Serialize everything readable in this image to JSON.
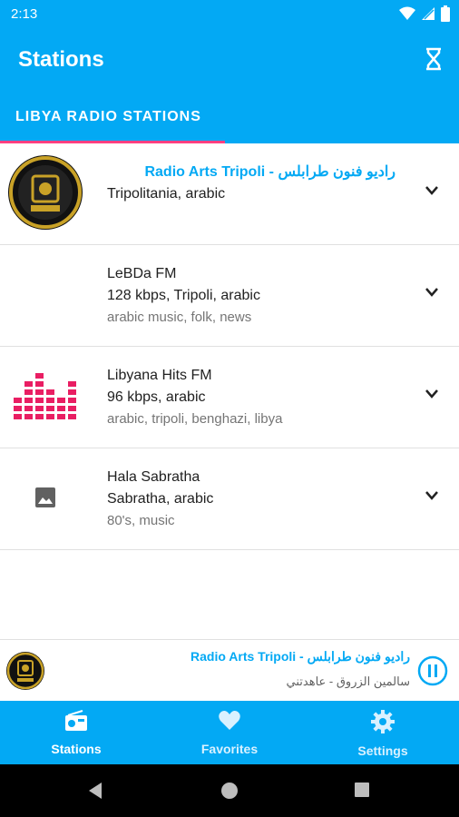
{
  "status_bar": {
    "time": "2:13"
  },
  "app_bar": {
    "title": "Stations"
  },
  "tabs": [
    {
      "label": "LIBYA RADIO STATIONS",
      "active": true
    }
  ],
  "stations": [
    {
      "name": "Radio Arts Tripoli - راديو فنون طرابلس",
      "line2": "Tripolitania, arabic",
      "line3": "",
      "thumb": "radio-arts-logo"
    },
    {
      "name": "LeBDa FM",
      "line2": "128 kbps, Tripoli, arabic",
      "line3": "arabic music, folk, news",
      "thumb": "none"
    },
    {
      "name": "Libyana Hits FM",
      "line2": "96 kbps, arabic",
      "line3": "arabic, tripoli, benghazi, libya",
      "thumb": "equalizer-logo"
    },
    {
      "name": "Hala Sabratha",
      "line2": "Sabratha, arabic",
      "line3": "80's, music",
      "thumb": "image-placeholder-icon"
    }
  ],
  "player": {
    "title": "Radio Arts Tripoli - راديو فنون طرابلس",
    "subtitle": "سالمين الزروق - عاهدتني",
    "state_icon": "pause-icon"
  },
  "bottom_nav": [
    {
      "label": "Stations",
      "icon": "radio-icon",
      "active": true
    },
    {
      "label": "Favorites",
      "icon": "heart-icon",
      "active": false
    },
    {
      "label": "Settings",
      "icon": "gear-icon",
      "active": false
    }
  ],
  "colors": {
    "primary": "#03a9f4",
    "accent": "#ff4081",
    "logo_pink": "#e91e63"
  }
}
